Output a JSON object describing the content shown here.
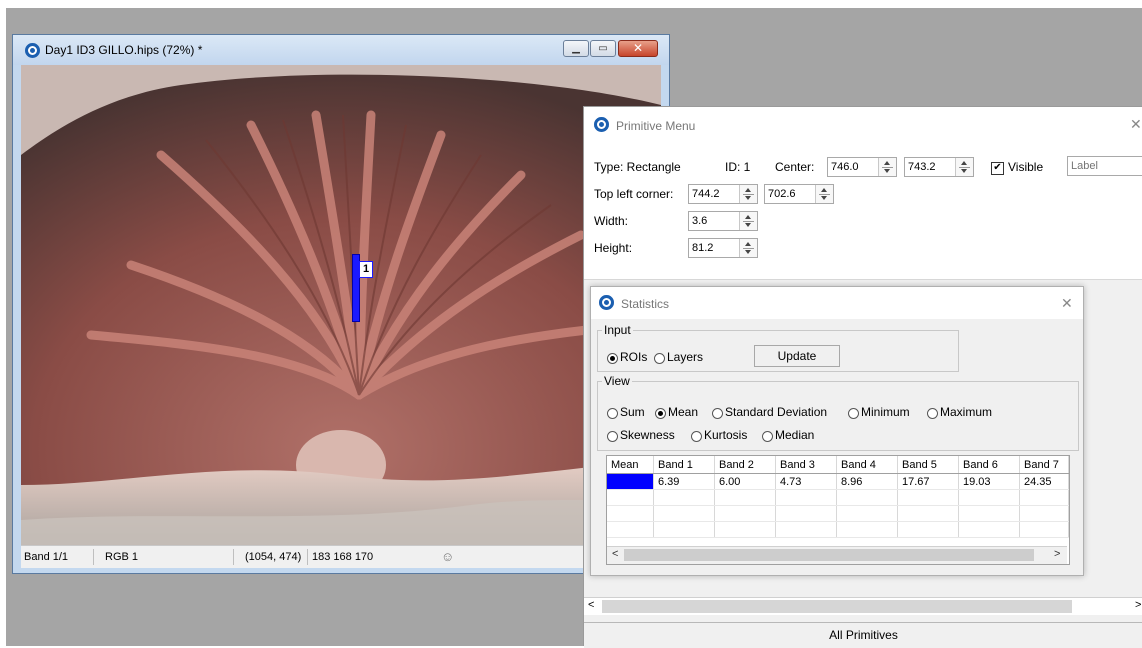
{
  "image_window": {
    "title": "Day1 ID3 GILLO.hips (72%) *",
    "roi_label": "1",
    "status": {
      "band": "Band 1/1",
      "mode": "RGB 1",
      "coords": "(1054, 474)",
      "values": "183 168 170",
      "icon": "mask-icon"
    }
  },
  "primitive_menu": {
    "title": "Primitive Menu",
    "type_label": "Type: Rectangle",
    "id_label": "ID: 1",
    "center_label": "Center:",
    "center_x": "746.0",
    "center_y": "743.2",
    "visible_label": "Visible",
    "visible_checked": true,
    "label_placeholder": "Label",
    "topleft_label": "Top left corner:",
    "topleft_x": "744.2",
    "topleft_y": "702.6",
    "width_label": "Width:",
    "width_value": "3.6",
    "height_label": "Height:",
    "height_value": "81.2",
    "footer_tab": "All Primitives"
  },
  "statistics": {
    "title": "Statistics",
    "input_group": "Input",
    "input_options": [
      "ROIs",
      "Layers"
    ],
    "input_selected": "ROIs",
    "update_label": "Update",
    "view_group": "View",
    "view_options_row1": [
      "Sum",
      "Mean",
      "Standard Deviation",
      "Minimum",
      "Maximum"
    ],
    "view_options_row2": [
      "Skewness",
      "Kurtosis",
      "Median"
    ],
    "view_selected": "Mean",
    "table": {
      "headers": [
        "Mean",
        "Band 1",
        "Band 2",
        "Band 3",
        "Band 4",
        "Band 5",
        "Band 6",
        "Band 7"
      ],
      "rows": [
        {
          "swatch": "#0000ff",
          "values": [
            "6.39",
            "6.00",
            "4.73",
            "8.96",
            "17.67",
            "19.03",
            "24.35"
          ]
        }
      ]
    }
  },
  "colors": {
    "roi": "#1a1aff",
    "titlebar": "#c6d9f0",
    "close": "#c7452b"
  }
}
